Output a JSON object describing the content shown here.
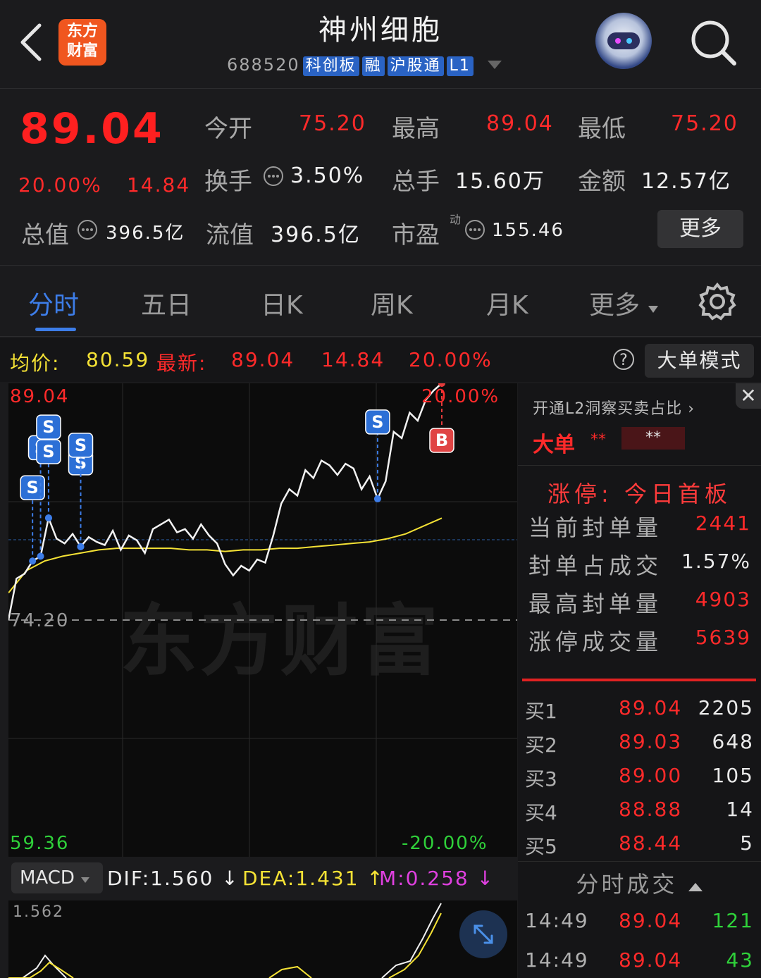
{
  "header": {
    "logo_text_line1": "东方",
    "logo_text_line2": "财富",
    "stock_name": "神州细胞",
    "stock_code": "688520",
    "tags": [
      "科创板",
      "融",
      "沪股通",
      "L1"
    ]
  },
  "quote": {
    "price": "89.04",
    "change_pct": "20.00%",
    "change_abs": "14.84",
    "open_label": "今开",
    "open": "75.20",
    "high_label": "最高",
    "high": "89.04",
    "low_label": "最低",
    "low": "75.20",
    "turnover_label": "换手",
    "turnover": "3.50%",
    "volume_label": "总手",
    "volume": "15.60万",
    "amount_label": "金额",
    "amount": "12.57亿",
    "mktcap_label": "总值",
    "mktcap": "396.5亿",
    "float_label": "流值",
    "float_cap": "396.5亿",
    "pe_label": "市盈",
    "pe_super": "动",
    "pe": "155.46",
    "more": "更多"
  },
  "tabs": [
    "分时",
    "五日",
    "日K",
    "周K",
    "月K",
    "更多"
  ],
  "infobar": {
    "avg_label": "均价:",
    "avg": "80.59",
    "latest_label": "最新:",
    "latest": "89.04",
    "chg": "14.84",
    "pct": "20.00%",
    "help": "?",
    "big_order_mode": "大单模式"
  },
  "chart": {
    "top_price": "89.04",
    "top_pct": "20.00%",
    "mid_price": "74.20",
    "bottom_price": "59.36",
    "bottom_pct": "-20.00%",
    "watermark": "东方财富",
    "sell_marker": "S",
    "buy_marker": "B"
  },
  "chart_data": {
    "type": "line",
    "xlabel": "",
    "ylabel": "",
    "ylim": [
      59.36,
      89.04
    ],
    "series": [
      {
        "values": [
          74.2,
          76.8,
          77.1,
          77.9,
          78.2,
          80.6,
          79.3,
          79.0,
          79.6,
          78.8,
          79.4,
          79.1,
          78.9,
          79.8,
          78.6,
          79.5,
          79.2,
          78.4,
          79.9,
          80.2,
          80.5,
          79.7,
          79.9,
          79.3,
          80.2,
          79.5,
          79.0,
          77.7,
          77.0,
          77.6,
          77.3,
          78.0,
          77.8,
          79.5,
          81.5,
          82.4,
          82.0,
          83.6,
          83.1,
          84.2,
          83.9,
          83.3,
          84.0,
          83.7,
          82.4,
          83.2,
          81.8,
          82.9,
          86.0,
          85.6,
          87.2,
          86.7,
          88.0,
          88.6,
          89.04
        ]
      },
      {
        "values": [
          75.9,
          77.3,
          77.9,
          78.2,
          78.4,
          78.6,
          78.7,
          78.7,
          78.7,
          78.7,
          78.6,
          78.6,
          78.5,
          78.6,
          78.6,
          78.7,
          78.7,
          78.8,
          78.9,
          79.0,
          79.1,
          79.3,
          79.6,
          80.1,
          80.59
        ]
      }
    ]
  },
  "macd": {
    "label": "MACD",
    "dif": "DIF:1.560",
    "dea": "DEA:1.431",
    "m": "M:0.258",
    "top": "1.562"
  },
  "rightpanel": {
    "l2_title": "开通L2洞察买卖占比",
    "big_order": "大单",
    "stars1": "**",
    "stars2": "**",
    "limit_title": "涨停: 今日首板",
    "stats": [
      {
        "label": "当前封单量",
        "value": "2441"
      },
      {
        "label": "封单占成交",
        "value": "1.57%"
      },
      {
        "label": "最高封单量",
        "value": "4903"
      },
      {
        "label": "涨停成交量",
        "value": "5639"
      }
    ],
    "bids": [
      {
        "label": "买1",
        "price": "89.04",
        "vol": "2205"
      },
      {
        "label": "买2",
        "price": "89.03",
        "vol": "648"
      },
      {
        "label": "买3",
        "price": "89.00",
        "vol": "105"
      },
      {
        "label": "买4",
        "price": "88.88",
        "vol": "14"
      },
      {
        "label": "买5",
        "price": "88.44",
        "vol": "5"
      }
    ],
    "trades_title": "分时成交",
    "trades": [
      {
        "time": "14:49",
        "price": "89.04",
        "vol": "121"
      },
      {
        "time": "14:49",
        "price": "89.04",
        "vol": "43"
      }
    ]
  },
  "colors": {
    "up": "#ff2a2a",
    "down": "#2fd13a",
    "accent": "#3d7de8",
    "avg_line": "#f5e235"
  }
}
